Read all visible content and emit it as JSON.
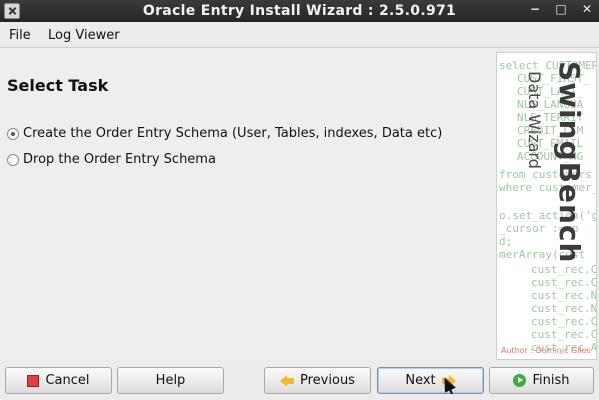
{
  "window": {
    "title": "Oracle Entry Install Wizard : 2.5.0.971",
    "controls": {
      "minimize": "−",
      "maximize": "□",
      "close": "✕"
    }
  },
  "menu": {
    "file": "File",
    "log_viewer": "Log Viewer"
  },
  "task": {
    "heading": "Select Task",
    "options": [
      {
        "label": "Create the Order Entry Schema (User, Tables, indexes, Data etc)",
        "selected": true
      },
      {
        "label": "Drop the Order Entry Schema",
        "selected": false
      }
    ]
  },
  "banner": {
    "brand": "SwingBench",
    "subtitle": "Data Wizard",
    "author": "Author : Dominic Giles",
    "code_lines": [
      "select CUSTOMER_",
      "CUST_FIRST_",
      "CUST_LAST_",
      "NLS_LANGUA",
      "NLS_TERRIT",
      "CREDIT_LIM",
      "CUST_EMAIL",
      "ACCOUNT_MG",
      "from customers",
      "where customer_id",
      "o.set_action('g",
      "_cursor := p",
      "d;",
      "merArray(cust",
      "cust_rec.C",
      "cust_rec.C",
      "cust_rec.N",
      "cust_rec.N",
      "cust_rec.C",
      "cust_rec.C",
      "cust_rec.A"
    ]
  },
  "buttons": {
    "cancel": "Cancel",
    "help": "Help",
    "previous": "Previous",
    "next": "Next",
    "finish": "Finish"
  },
  "colors": {
    "titlebar": "#2e2e2e",
    "banner_code": "#9fc79f",
    "cancel_icon": "#e04040",
    "arrow_icon": "#f0b930",
    "finish_icon": "#3cae3c"
  }
}
